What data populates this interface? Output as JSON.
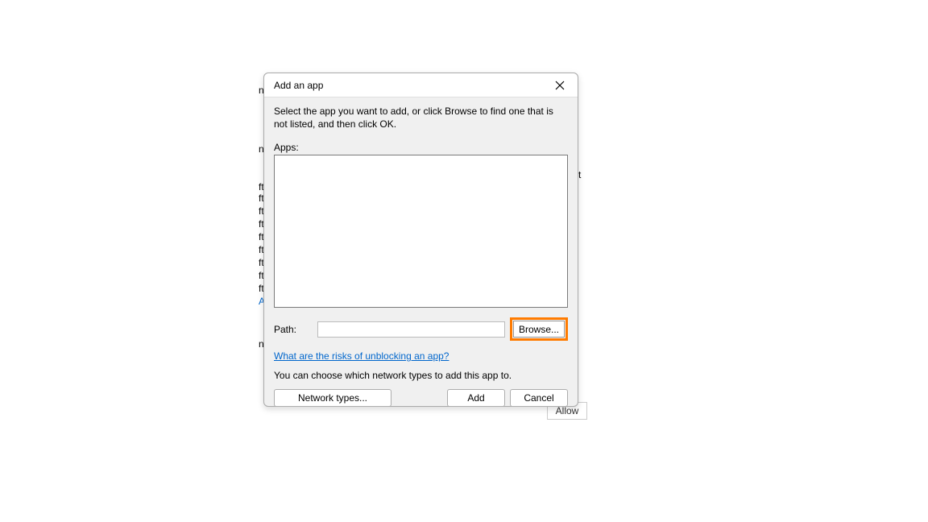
{
  "dialog": {
    "title": "Add an app",
    "instruction": "Select the app you want to add, or click Browse to find one that is not listed, and then click OK.",
    "apps_label": "Apps:",
    "path_label": "Path:",
    "path_value": "",
    "browse_label": "Browse...",
    "risk_link": "What are the risks of unblocking an app?",
    "network_text": "You can choose which network types to add this app to.",
    "buttons": {
      "network_types": "Network types...",
      "add": "Add",
      "cancel": "Cancel"
    }
  },
  "background": {
    "fragments": {
      "n1": "n",
      "ft": "ft",
      "a": "A",
      "t": "t"
    },
    "allow_button": "Allow"
  }
}
